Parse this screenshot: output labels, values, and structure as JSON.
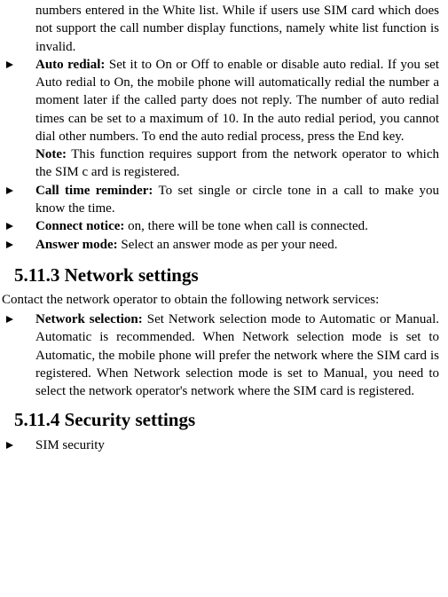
{
  "items": {
    "intro_continued": "numbers entered in the White list. While if users use SIM card which does not support the call number display functions, namely white list function is invalid.",
    "auto_redial_label": "Auto redial:",
    "auto_redial_text": " Set it to On or Off to enable or disable auto redial. If you set Auto redial to On, the mobile phone will automatically redial the number a moment later if the called party does not reply. The number of auto redial times can be set to a maximum of 10. In the auto redial period, you cannot dial other numbers. To end the auto redial process, press the End key.",
    "note_label": "Note:",
    "note_text": " This function requires support from the network operator to which the SIM c ard is registered.",
    "call_time_label": "Call time reminder:",
    "call_time_text": " To set single or circle tone in a call to make you know the time.",
    "connect_label": "Connect notice:",
    "connect_text": " on, there will be tone when call is connected.",
    "answer_label": "Answer mode:",
    "answer_text": " Select an answer mode as per your need."
  },
  "section_network": {
    "heading": "5.11.3  Network settings",
    "intro": "Contact the network operator to obtain the following network services:",
    "network_sel_label": "Network selection:",
    "network_sel_text": " Set Network selection mode to Automatic or Manual. Automatic is recommended. When Network selection mode is set to Automatic, the mobile phone will prefer the network where the SIM card is registered. When Network selection mode is set to Manual, you need to select the network operator's network where the SIM card is registered."
  },
  "section_security": {
    "heading": "5.11.4  Security settings",
    "sim_security": "SIM security"
  }
}
